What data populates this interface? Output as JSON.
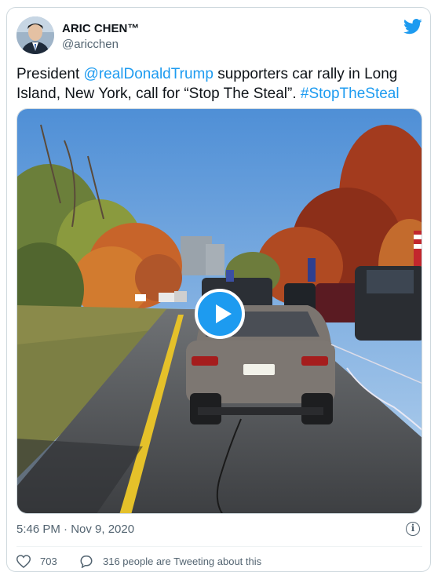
{
  "tweet": {
    "author_name": "ARIC CHEN™",
    "author_handle": "@aricchen",
    "text_before": "President ",
    "mention": "@realDonaldTrump",
    "text_after": " supporters car rally in Long Island, New York, call for “Stop The Steal”.  ",
    "hashtag": "#StopTheSteal",
    "timestamp": "5:46 PM · Nov 9, 2020",
    "like_count": "703",
    "reply_text": "316 people are Tweeting about this"
  },
  "icons": {
    "brand": "twitter-bird-icon",
    "play": "play-icon",
    "info": "info-icon",
    "like": "heart-icon",
    "reply": "speech-bubble-icon"
  },
  "colors": {
    "accent": "#1d9bf0",
    "text": "#0f1419",
    "muted": "#536471"
  }
}
